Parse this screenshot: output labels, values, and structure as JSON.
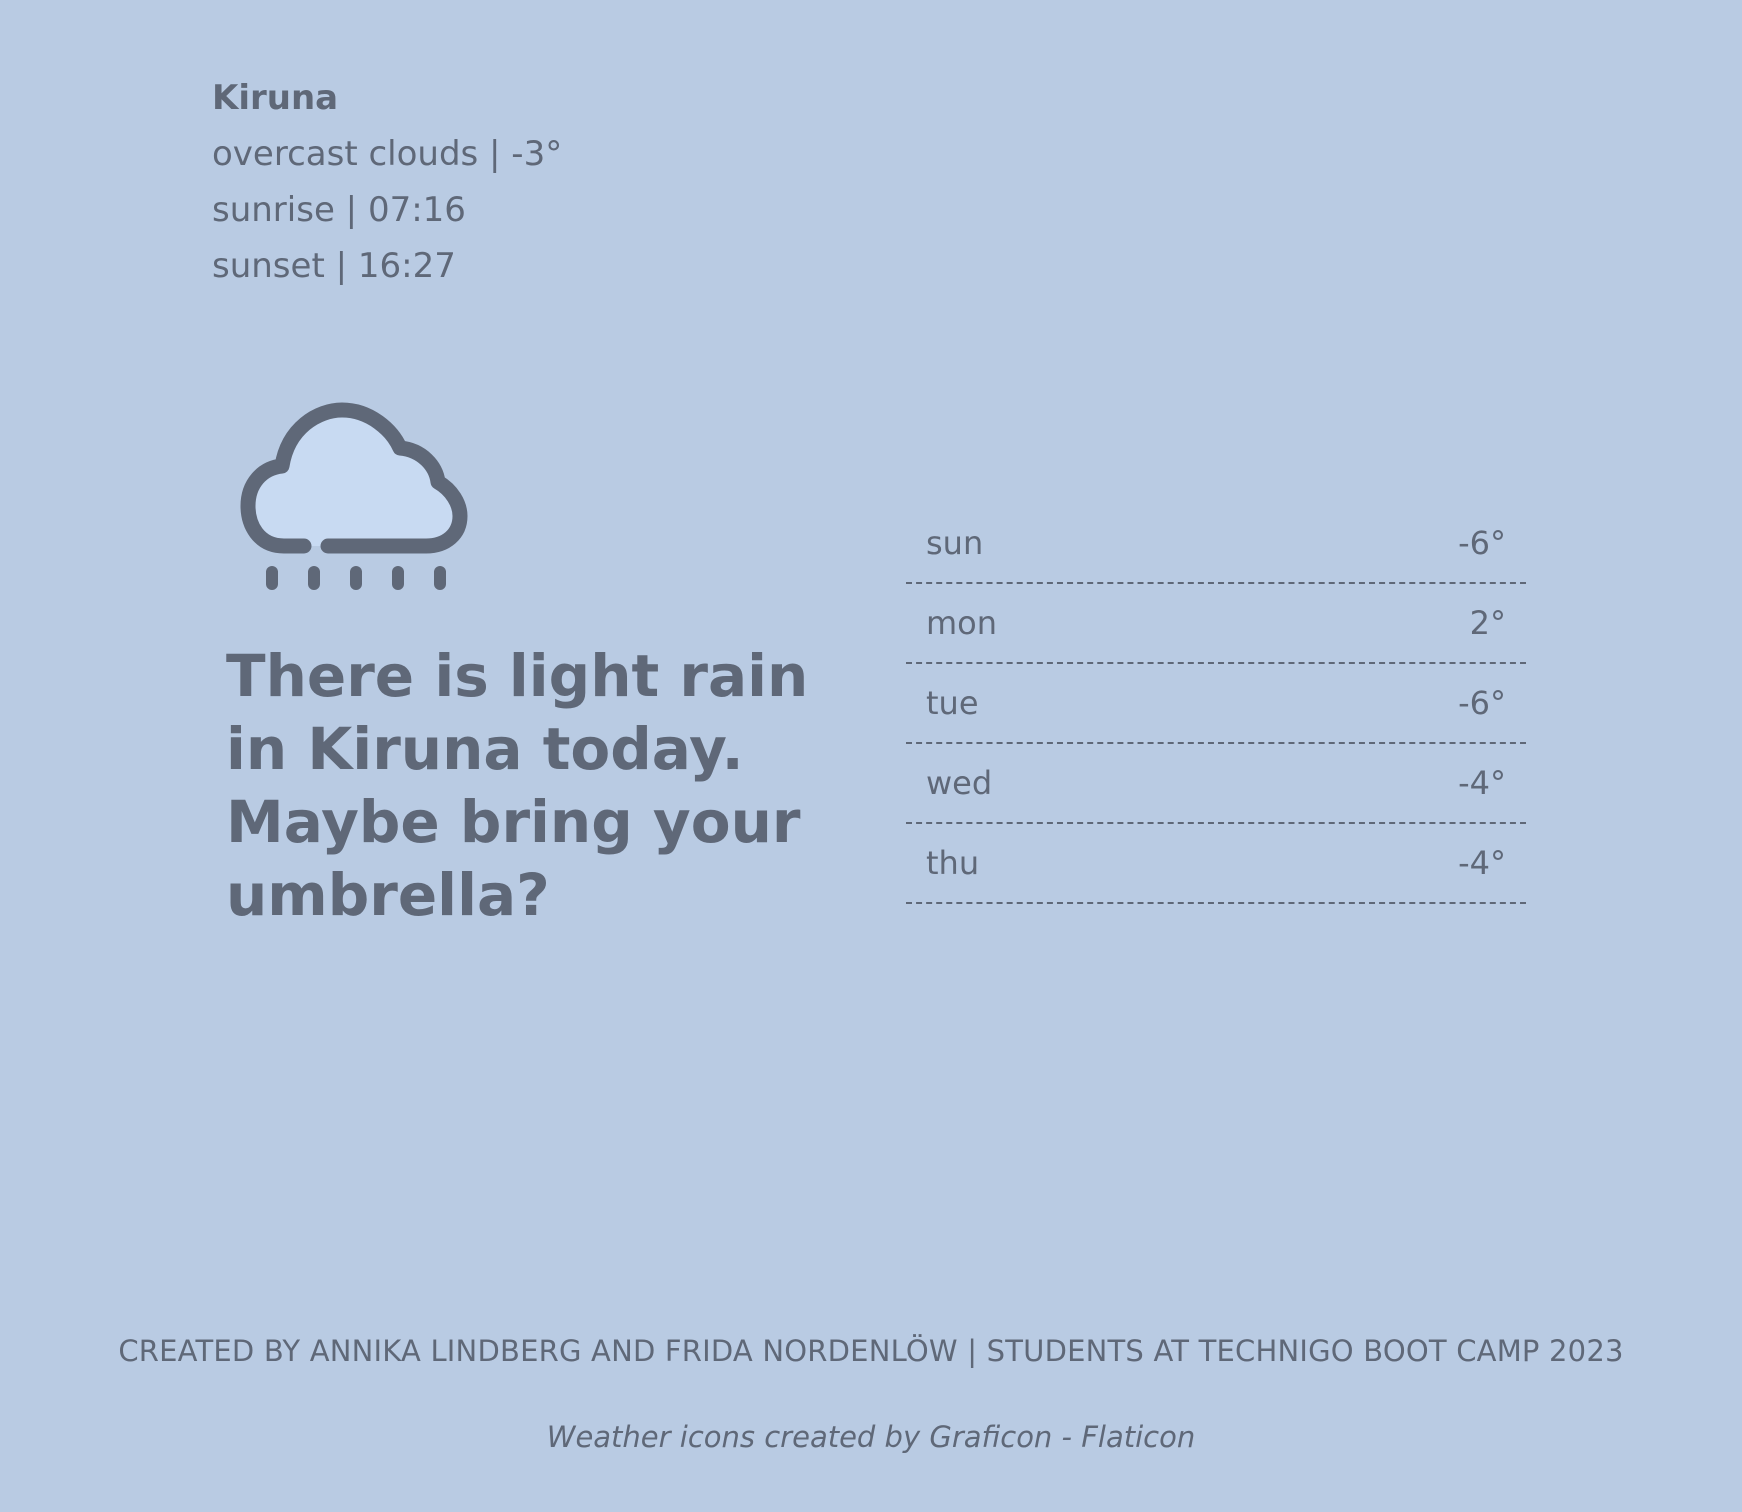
{
  "current": {
    "city": "Kiruna",
    "description_line": "overcast clouds | -3°",
    "sunrise_line": "sunrise | 07:16",
    "sunset_line": "sunset | 16:27"
  },
  "icon": "rain-cloud-icon",
  "headline": "There is light rain in Kiruna today. Maybe bring your umbrella?",
  "forecast": [
    {
      "day": "sun",
      "temp": "-6°"
    },
    {
      "day": "mon",
      "temp": "2°"
    },
    {
      "day": "tue",
      "temp": "-6°"
    },
    {
      "day": "wed",
      "temp": "-4°"
    },
    {
      "day": "thu",
      "temp": "-4°"
    }
  ],
  "footer": {
    "credit": "CREATED BY ANNIKA LINDBERG AND FRIDA NORDENLÖW | STUDENTS AT TECHNIGO BOOT CAMP 2023",
    "icons_credit": "Weather icons created by Graficon - Flaticon"
  },
  "colors": {
    "background": "#b9cbe3",
    "text": "#5f6878",
    "cloud_fill": "#c8daf2"
  }
}
